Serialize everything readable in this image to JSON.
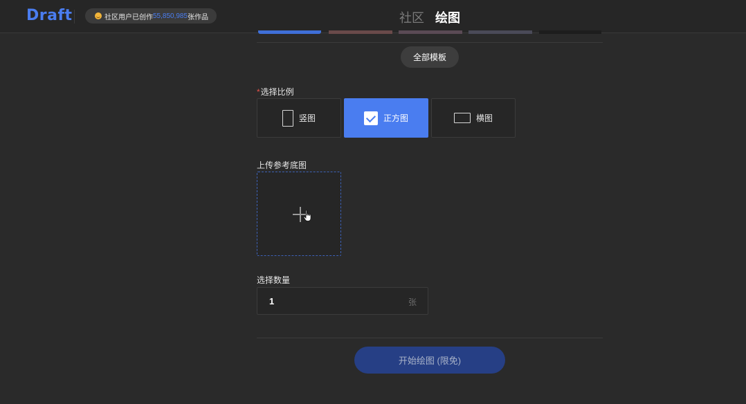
{
  "header": {
    "logo": "Draft",
    "stats": {
      "prefix": "社区用户已创作",
      "count": "55,850,985",
      "suffix": "张作品"
    },
    "tabs": [
      {
        "label": "社区",
        "active": false
      },
      {
        "label": "绘图",
        "active": true
      }
    ]
  },
  "templates": {
    "all_label": "全部模板"
  },
  "ratio": {
    "label": "选择比例",
    "required_mark": "*",
    "options": [
      {
        "label": "竖图",
        "icon": "portrait-icon",
        "selected": false
      },
      {
        "label": "正方图",
        "icon": "check-icon",
        "selected": true
      },
      {
        "label": "横图",
        "icon": "landscape-icon",
        "selected": false
      }
    ]
  },
  "upload": {
    "label": "上传参考底图",
    "icon": "plus-icon"
  },
  "quantity": {
    "label": "选择数量",
    "value": "1",
    "unit": "张"
  },
  "start_button": {
    "label": "开始绘图 (限免)"
  },
  "colors": {
    "accent": "#4a7df0",
    "background": "#2a2a2a",
    "required": "#e8534b",
    "start_button_bg": "#263f85"
  }
}
